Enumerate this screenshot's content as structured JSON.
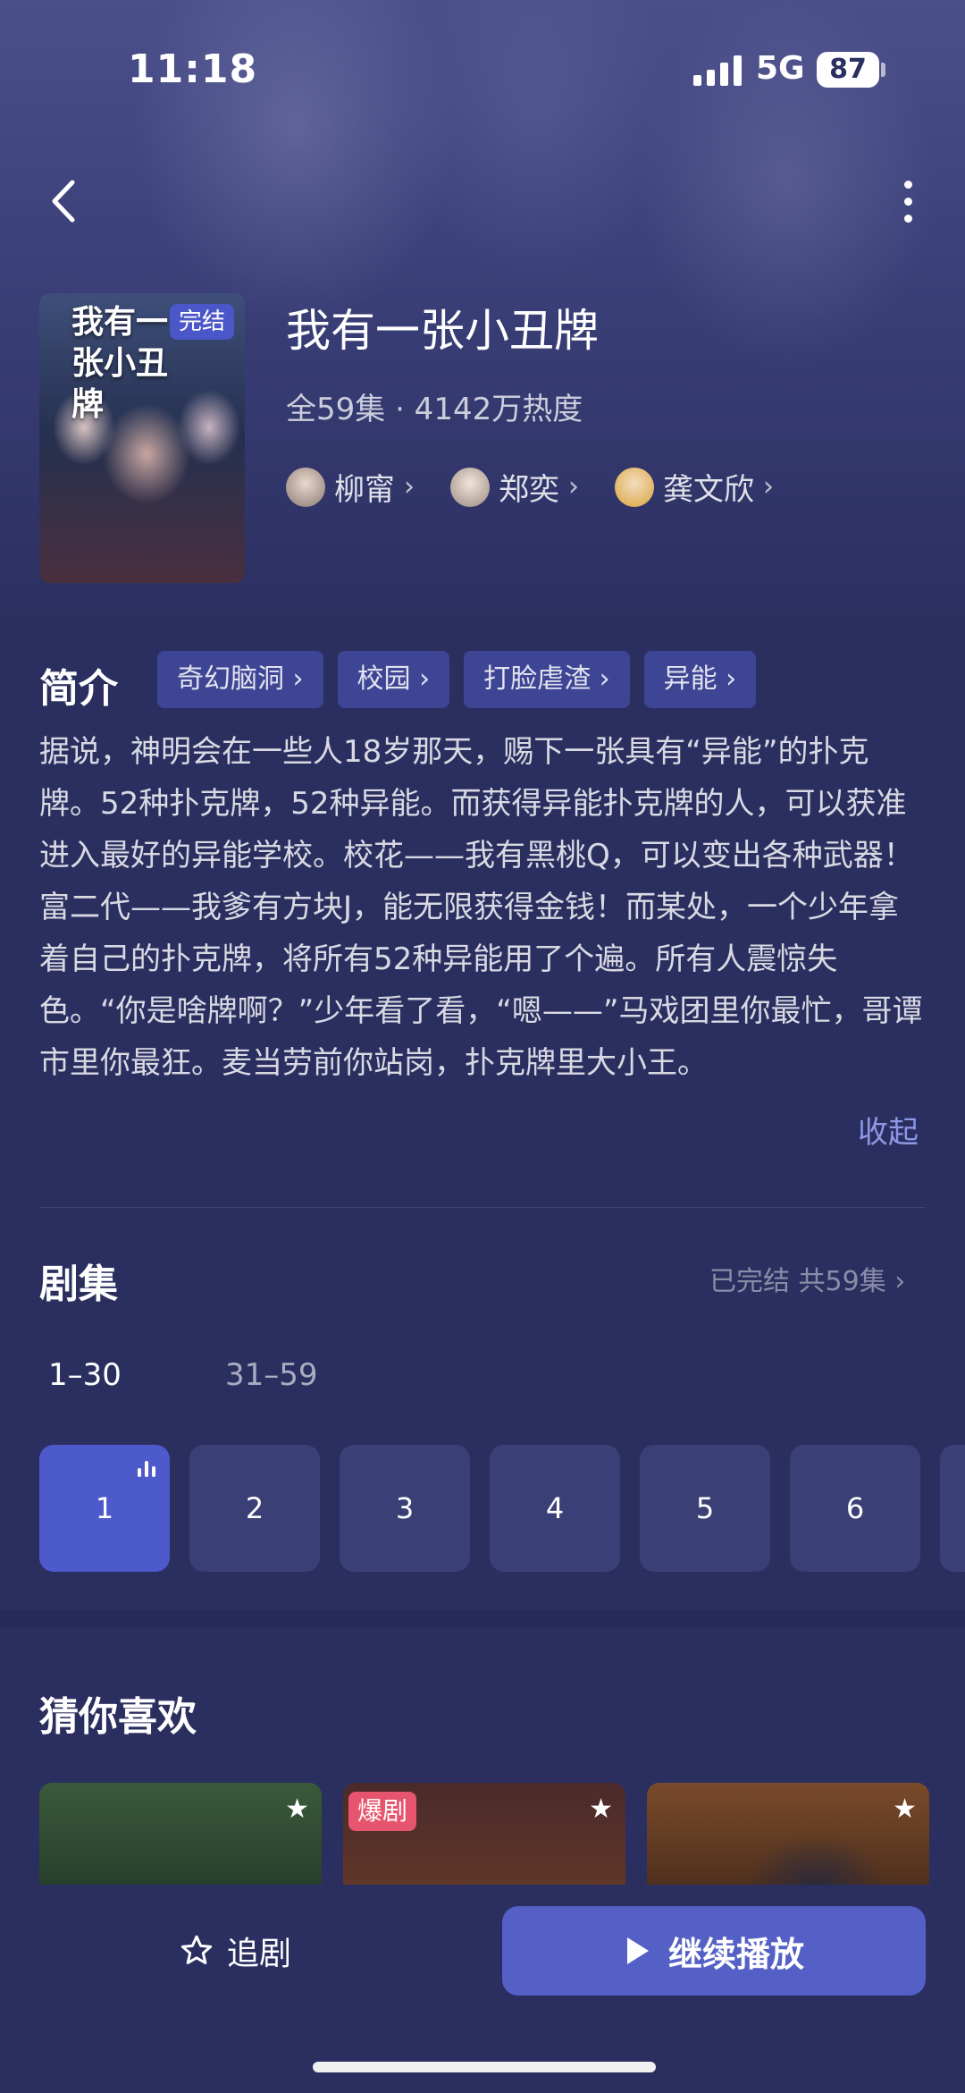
{
  "status_bar": {
    "time": "11:18",
    "network": "5G",
    "battery": "87"
  },
  "drama": {
    "poster_title": "我有一张小丑牌",
    "poster_badge": "完结",
    "title": "我有一张小丑牌",
    "meta": "全59集 · 4142万热度",
    "cast": [
      {
        "name": "柳甯",
        "chevron": "›"
      },
      {
        "name": "郑奕",
        "chevron": "›"
      },
      {
        "name": "龚文欣",
        "chevron": "›"
      }
    ]
  },
  "intro": {
    "label": "简介",
    "tags": [
      "奇幻脑洞 ›",
      "校园 ›",
      "打脸虐渣 ›",
      "异能 ›"
    ],
    "description": "据说，神明会在一些人18岁那天，赐下一张具有“异能”的扑克牌。52种扑克牌，52种异能。而获得异能扑克牌的人，可以获准进入最好的异能学校。校花——我有黑桃Q，可以变出各种武器！富二代——我爹有方块J，能无限获得金钱！而某处，一个少年拿着自己的扑克牌，将所有52种异能用了个遍。所有人震惊失色。“你是啥牌啊？”少年看了看，“嗯——”马戏团里你最忙，哥谭市里你最狂。麦当劳前你站岗，扑克牌里大小王。",
    "collapse": "收起"
  },
  "episodes": {
    "label": "剧集",
    "status": "已完结 共59集 ›",
    "ranges": [
      "1–30",
      "31–59"
    ],
    "items": [
      "1",
      "2",
      "3",
      "4",
      "5",
      "6"
    ],
    "current": "1"
  },
  "recommend": {
    "label": "猜你喜欢",
    "hot_badge": "爆剧",
    "star": "★"
  },
  "bottom": {
    "follow": "追剧",
    "play": "继续播放"
  },
  "colors": {
    "accent": "#5560c6",
    "background": "#2b2f60",
    "tag_bg": "#3d4594",
    "hot": "#e6556d"
  }
}
